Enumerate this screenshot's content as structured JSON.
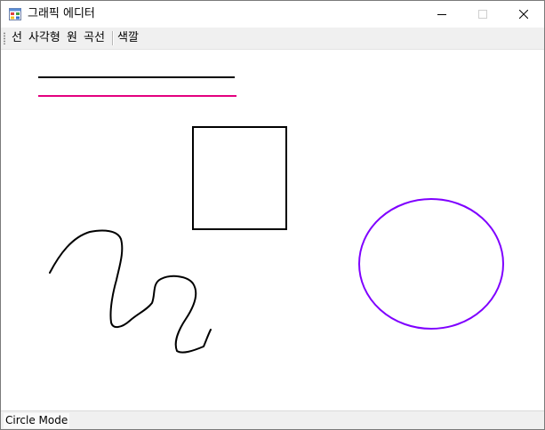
{
  "window": {
    "title": "그래픽 에디터",
    "icon": "app-window-icon"
  },
  "caption_buttons": {
    "minimize_icon": "minimize-icon",
    "maximize_icon": "maximize-icon",
    "close_icon": "close-icon"
  },
  "toolbar": {
    "items": [
      {
        "label": "선"
      },
      {
        "label": "사각형"
      },
      {
        "label": "원"
      },
      {
        "label": "곡선"
      },
      {
        "label": "색깔"
      }
    ]
  },
  "canvas": {
    "shapes": [
      {
        "type": "line",
        "color": "#000000"
      },
      {
        "type": "line",
        "color": "#e4007f"
      },
      {
        "type": "rectangle",
        "color": "#000000"
      },
      {
        "type": "circle",
        "color": "#7f00ff"
      },
      {
        "type": "curve",
        "color": "#000000"
      }
    ]
  },
  "statusbar": {
    "mode_text": "Circle Mode"
  }
}
